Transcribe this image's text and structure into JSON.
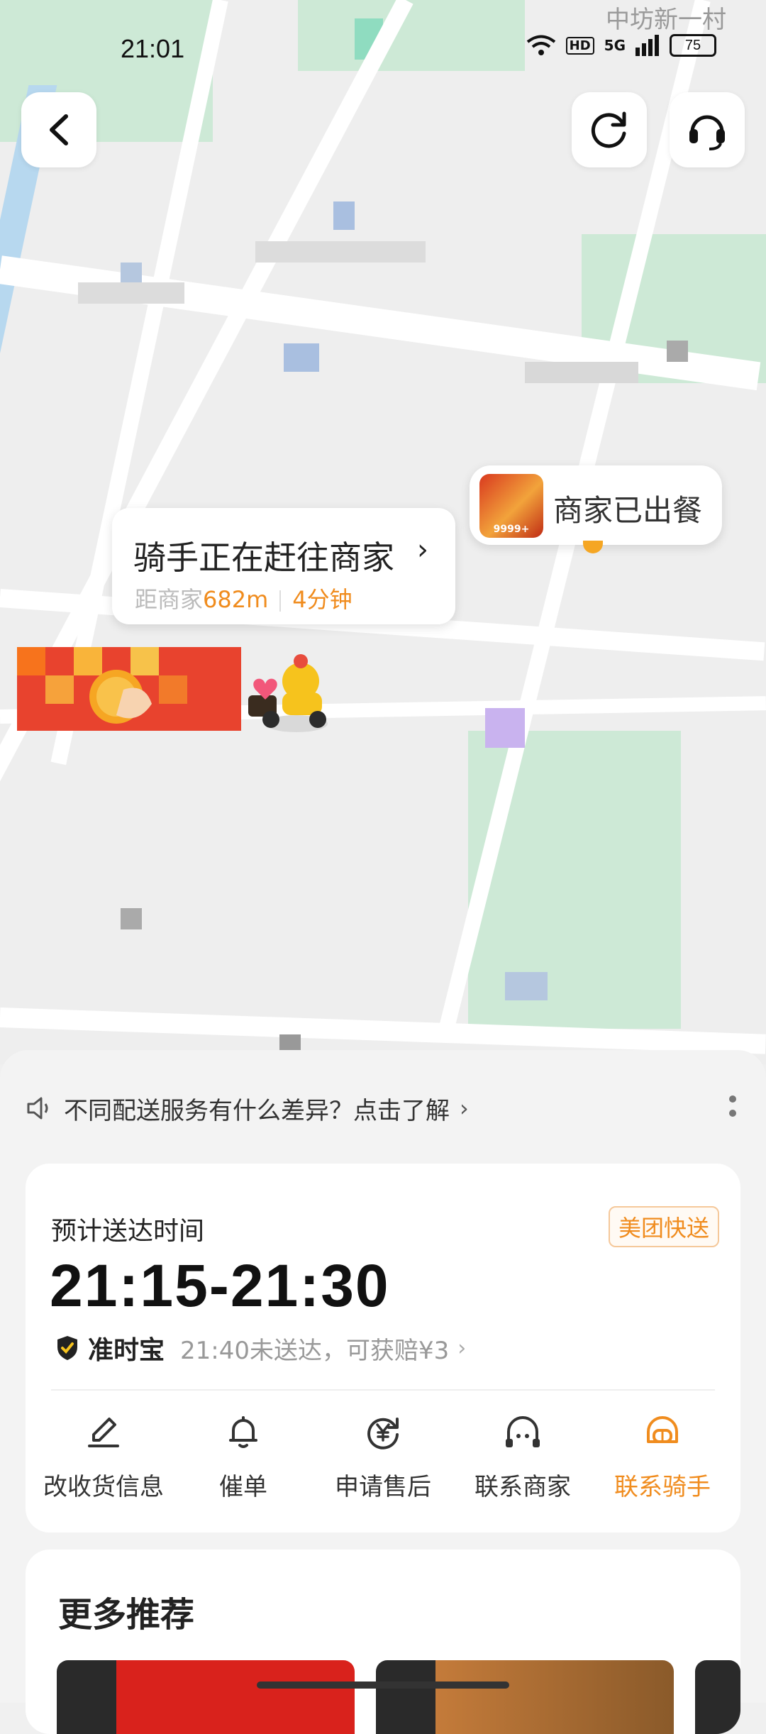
{
  "status_bar": {
    "time": "21:01",
    "network": "5G",
    "hd": "HD",
    "battery": "75"
  },
  "map": {
    "place_label": "中坊新一村"
  },
  "top_bar": {
    "back_icon": "back-arrow-icon",
    "refresh_icon": "refresh-icon",
    "support_icon": "headset-icon"
  },
  "rider_bubble": {
    "title": "骑手正在赶往商家",
    "distance_label": "距商家",
    "distance_value": "682m",
    "time_value": "4分钟"
  },
  "merchant_bubble": {
    "badge": "9999+",
    "status": "商家已出餐"
  },
  "notice": {
    "text": "不同配送服务有什么差异？点击了解"
  },
  "delivery_card": {
    "eta_label": "预计送达时间",
    "service_badge": "美团快送",
    "eta_time": "21:15-21:30",
    "ontime_name": "准时宝",
    "ontime_desc": "21:40未送达，可获赔¥3"
  },
  "actions": [
    {
      "label": "改收货信息",
      "icon": "edit-pen-icon"
    },
    {
      "label": "催单",
      "icon": "bell-icon"
    },
    {
      "label": "申请售后",
      "icon": "yuan-refund-icon"
    },
    {
      "label": "联系商家",
      "icon": "store-contact-icon"
    },
    {
      "label": "联系骑手",
      "icon": "rider-contact-icon"
    }
  ],
  "recommend": {
    "title": "更多推荐"
  },
  "colors": {
    "accent": "#f08c1e",
    "park": "#cde9d6",
    "map_bg": "#eeeeee"
  }
}
